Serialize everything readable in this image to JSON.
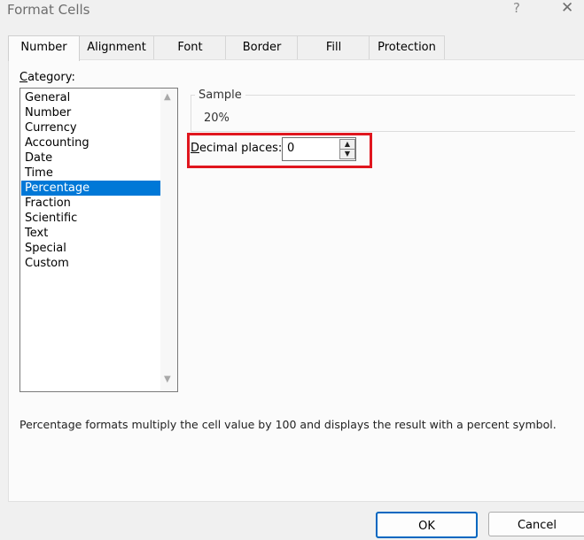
{
  "window": {
    "title": "Format Cells",
    "help_glyph": "?",
    "close_glyph": "✕"
  },
  "tabs": [
    {
      "label": "Number",
      "active": true
    },
    {
      "label": "Alignment",
      "active": false
    },
    {
      "label": "Font",
      "active": false
    },
    {
      "label": "Border",
      "active": false
    },
    {
      "label": "Fill",
      "active": false
    },
    {
      "label": "Protection",
      "active": false
    }
  ],
  "category": {
    "label_mnemonic": "C",
    "label_rest": "ategory:",
    "items": [
      "General",
      "Number",
      "Currency",
      "Accounting",
      "Date",
      "Time",
      "Percentage",
      "Fraction",
      "Scientific",
      "Text",
      "Special",
      "Custom"
    ],
    "selected": "Percentage"
  },
  "sample": {
    "legend": "Sample",
    "value": "20%"
  },
  "decimal_places": {
    "label_mnemonic": "D",
    "label_rest": "ecimal places:",
    "value": "0"
  },
  "description": "Percentage formats multiply the cell value by 100 and displays the result with a percent symbol.",
  "buttons": {
    "ok": "OK",
    "cancel": "Cancel"
  },
  "colors": {
    "selection": "#0078d7",
    "highlight_box": "#e0161e",
    "ok_border": "#0067c0"
  }
}
